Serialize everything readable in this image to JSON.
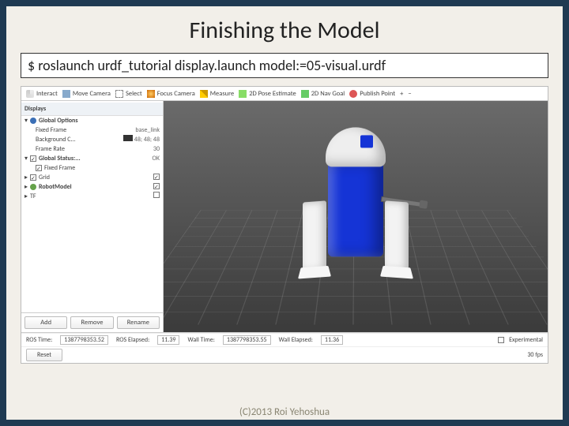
{
  "title": "Finishing the Model",
  "command": "$ roslaunch urdf_tutorial display.launch model:=05-visual.urdf",
  "copyright": "(C)2013 Roi Yehoshua",
  "toolbar": {
    "interact": "Interact",
    "move_camera": "Move Camera",
    "select": "Select",
    "focus_camera": "Focus Camera",
    "measure": "Measure",
    "pose_estimate": "2D Pose Estimate",
    "nav_goal": "2D Nav Goal",
    "publish_point": "Publish Point",
    "plus": "+",
    "minus": "−"
  },
  "tree": {
    "header": "Displays",
    "global_options": "Global Options",
    "fixed_frame_l": "Fixed Frame",
    "fixed_frame_v": "base_link",
    "background_l": "Background C...",
    "background_v": "48; 48; 48",
    "frame_rate_l": "Frame Rate",
    "frame_rate_v": "30",
    "global_status": "Global Status:...",
    "global_status_v": "OK",
    "fixed_frame2_l": "Fixed Frame",
    "grid": "Grid",
    "robot_model": "RobotModel",
    "tf": "TF"
  },
  "buttons": {
    "add": "Add",
    "remove": "Remove",
    "rename": "Rename"
  },
  "status": {
    "ros_time_l": "ROS Time:",
    "ros_time_v": "1387798353.52",
    "ros_elapsed_l": "ROS Elapsed:",
    "ros_elapsed_v": "11.39",
    "wall_time_l": "Wall Time:",
    "wall_time_v": "1387798353.55",
    "wall_elapsed_l": "Wall Elapsed:",
    "wall_elapsed_v": "11.36",
    "reset": "Reset",
    "experimental": "Experimental",
    "fps": "30 fps"
  }
}
